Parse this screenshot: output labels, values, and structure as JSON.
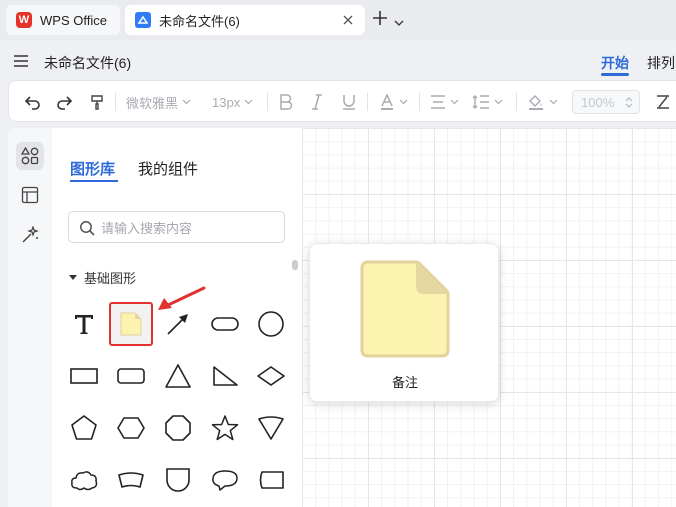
{
  "tabs": {
    "app_tab": {
      "label": "WPS Office",
      "logo": "W"
    },
    "doc_tab": {
      "label": "未命名文件(6)"
    }
  },
  "title_bar": {
    "doc_title": "未命名文件(6)",
    "ribbon_tabs": [
      "开始",
      "排列"
    ]
  },
  "toolbar": {
    "font_family": "微软雅黑",
    "font_size": "13px",
    "zoom": "100%"
  },
  "panel": {
    "tabs": [
      "图形库",
      "我的组件"
    ],
    "search_placeholder": "请输入搜索内容",
    "section_title": "基础图形"
  },
  "preview": {
    "label": "备注"
  },
  "colors": {
    "accent": "#2f6bd8",
    "wps_red": "#e5332a",
    "highlight": "#e0322e",
    "note_fill": "#fdf3b0",
    "note_stroke": "#e3d29a"
  }
}
